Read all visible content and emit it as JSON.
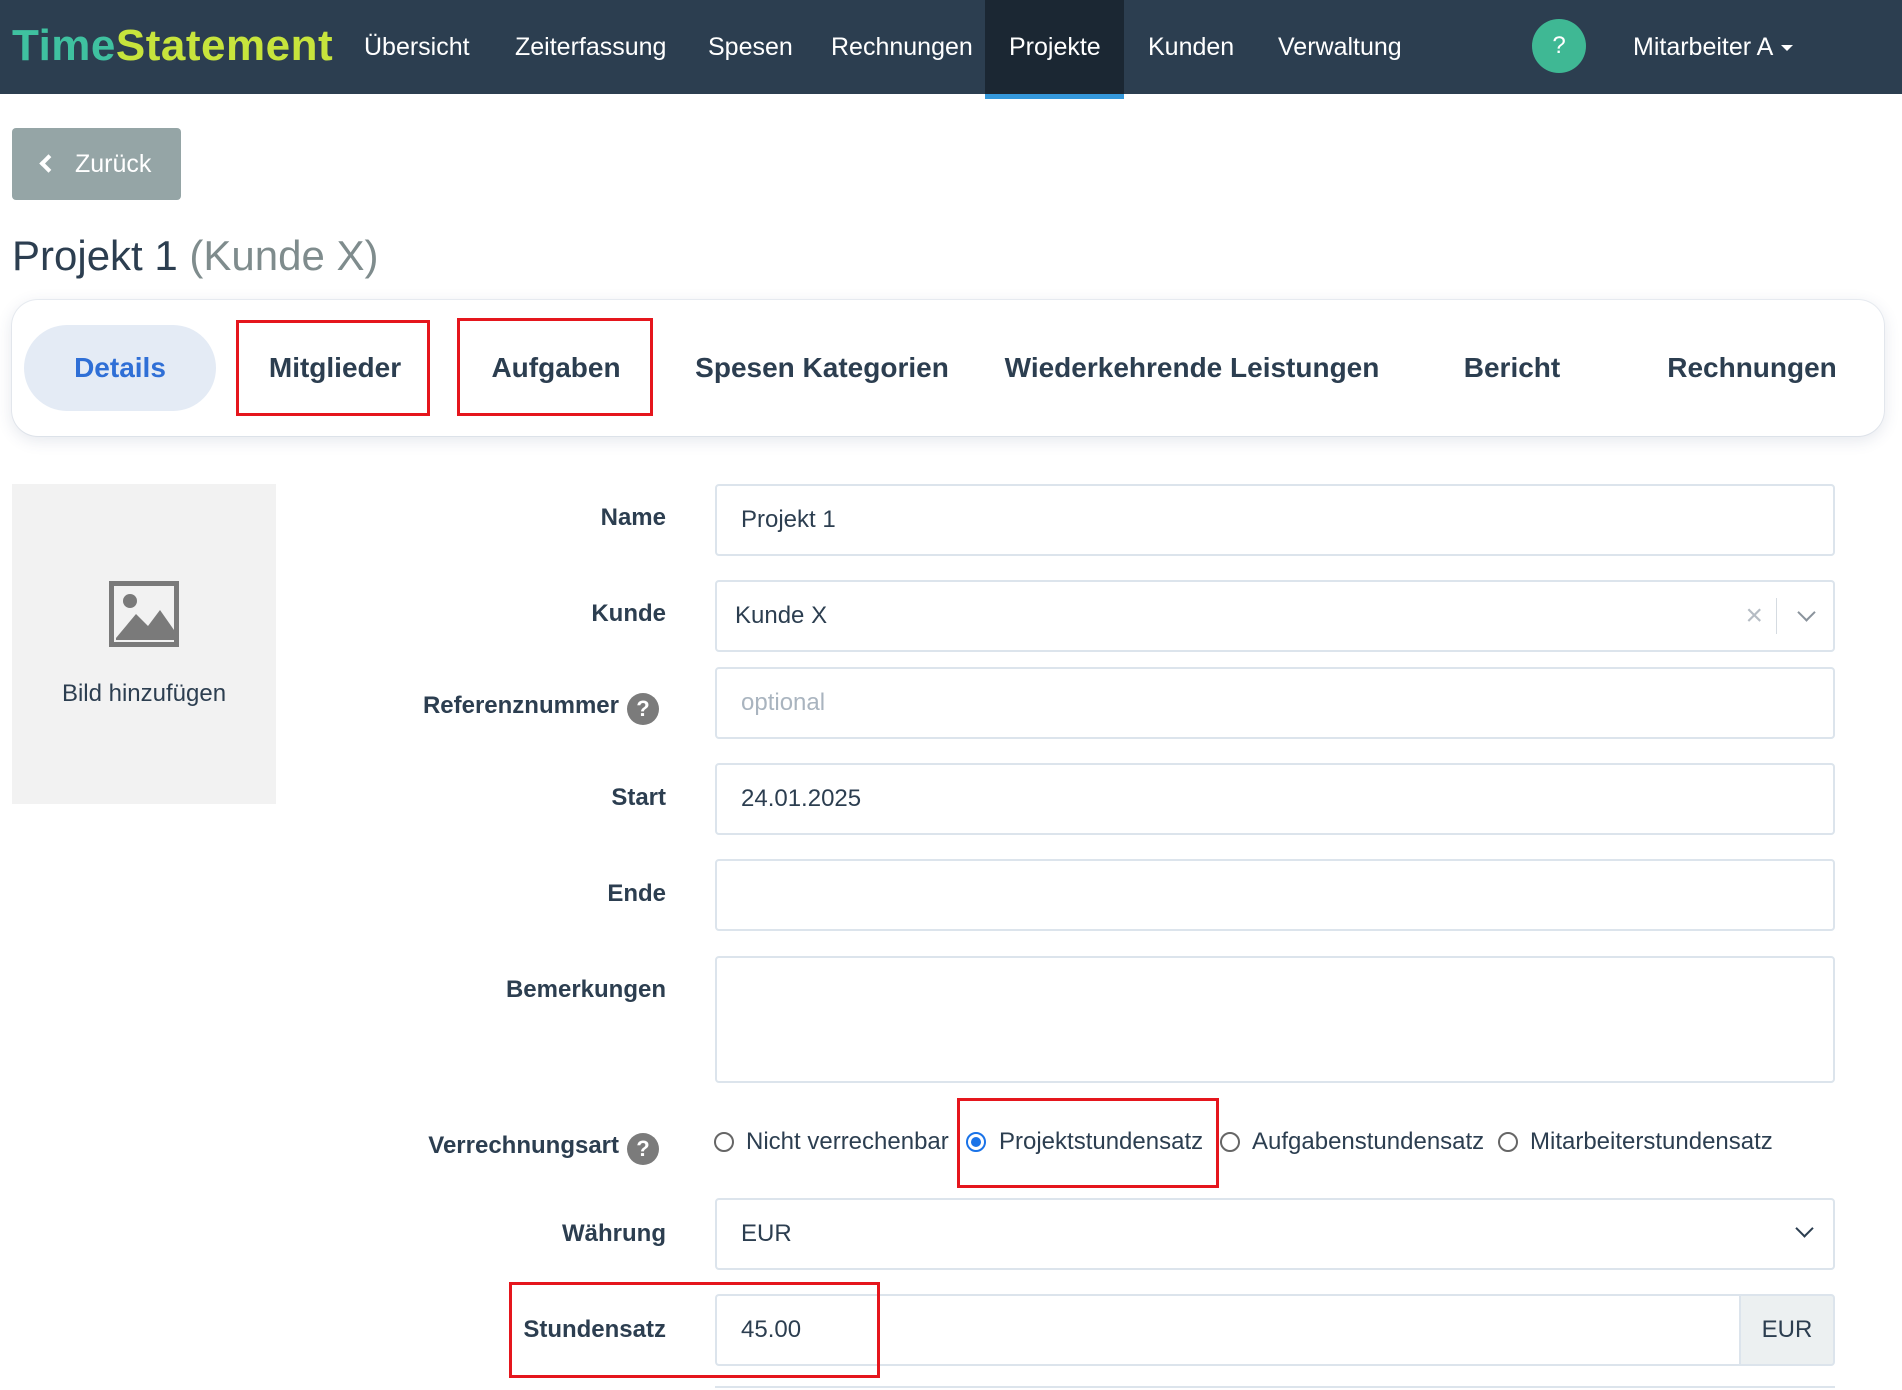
{
  "navbar": {
    "brand_part1": "Time",
    "brand_part2": "Statement",
    "items": [
      {
        "label": "Übersicht"
      },
      {
        "label": "Zeiterfassung"
      },
      {
        "label": "Spesen"
      },
      {
        "label": "Rechnungen"
      },
      {
        "label": "Projekte",
        "active": true
      },
      {
        "label": "Kunden"
      },
      {
        "label": "Verwaltung"
      }
    ],
    "help_label": "?",
    "user_label": "Mitarbeiter A"
  },
  "back_button": {
    "label": "Zurück"
  },
  "page_title": {
    "main": "Projekt 1",
    "sub": "(Kunde X)"
  },
  "tabs": [
    {
      "label": "Details",
      "active": true
    },
    {
      "label": "Mitglieder",
      "highlighted": true
    },
    {
      "label": "Aufgaben",
      "highlighted": true
    },
    {
      "label": "Spesen Kategorien"
    },
    {
      "label": "Wiederkehrende Leistungen"
    },
    {
      "label": "Bericht"
    },
    {
      "label": "Rechnungen"
    }
  ],
  "image_placeholder": {
    "label": "Bild hinzufügen",
    "icon": "image-icon"
  },
  "form": {
    "name": {
      "label": "Name",
      "value": "Projekt 1"
    },
    "customer": {
      "label": "Kunde",
      "value": "Kunde X",
      "clear_symbol": "×"
    },
    "reference": {
      "label": "Referenznummer",
      "help": "?",
      "placeholder": "optional"
    },
    "start": {
      "label": "Start",
      "value": "24.01.2025"
    },
    "end": {
      "label": "Ende",
      "value": ""
    },
    "notes": {
      "label": "Bemerkungen",
      "value": ""
    },
    "billing_type": {
      "label": "Verrechnungsart",
      "help": "?",
      "options": [
        {
          "label": "Nicht verrechenbar",
          "checked": false
        },
        {
          "label": "Projektstundensatz",
          "checked": true,
          "highlighted": true
        },
        {
          "label": "Aufgabenstundensatz",
          "checked": false
        },
        {
          "label": "Mitarbeiterstundensatz",
          "checked": false
        }
      ]
    },
    "currency": {
      "label": "Währung",
      "value": "EUR"
    },
    "hourly_rate": {
      "label": "Stundensatz",
      "value": "45.00",
      "unit": "EUR",
      "highlighted": true
    }
  },
  "colors": {
    "navbar_bg": "#2c3e50",
    "brand_time": "#3fc1a0",
    "brand_statement": "#c7e43c",
    "active_tab_text": "#2f6fd6",
    "highlight_box": "#e5161d",
    "help_circle": "#3fb894"
  }
}
